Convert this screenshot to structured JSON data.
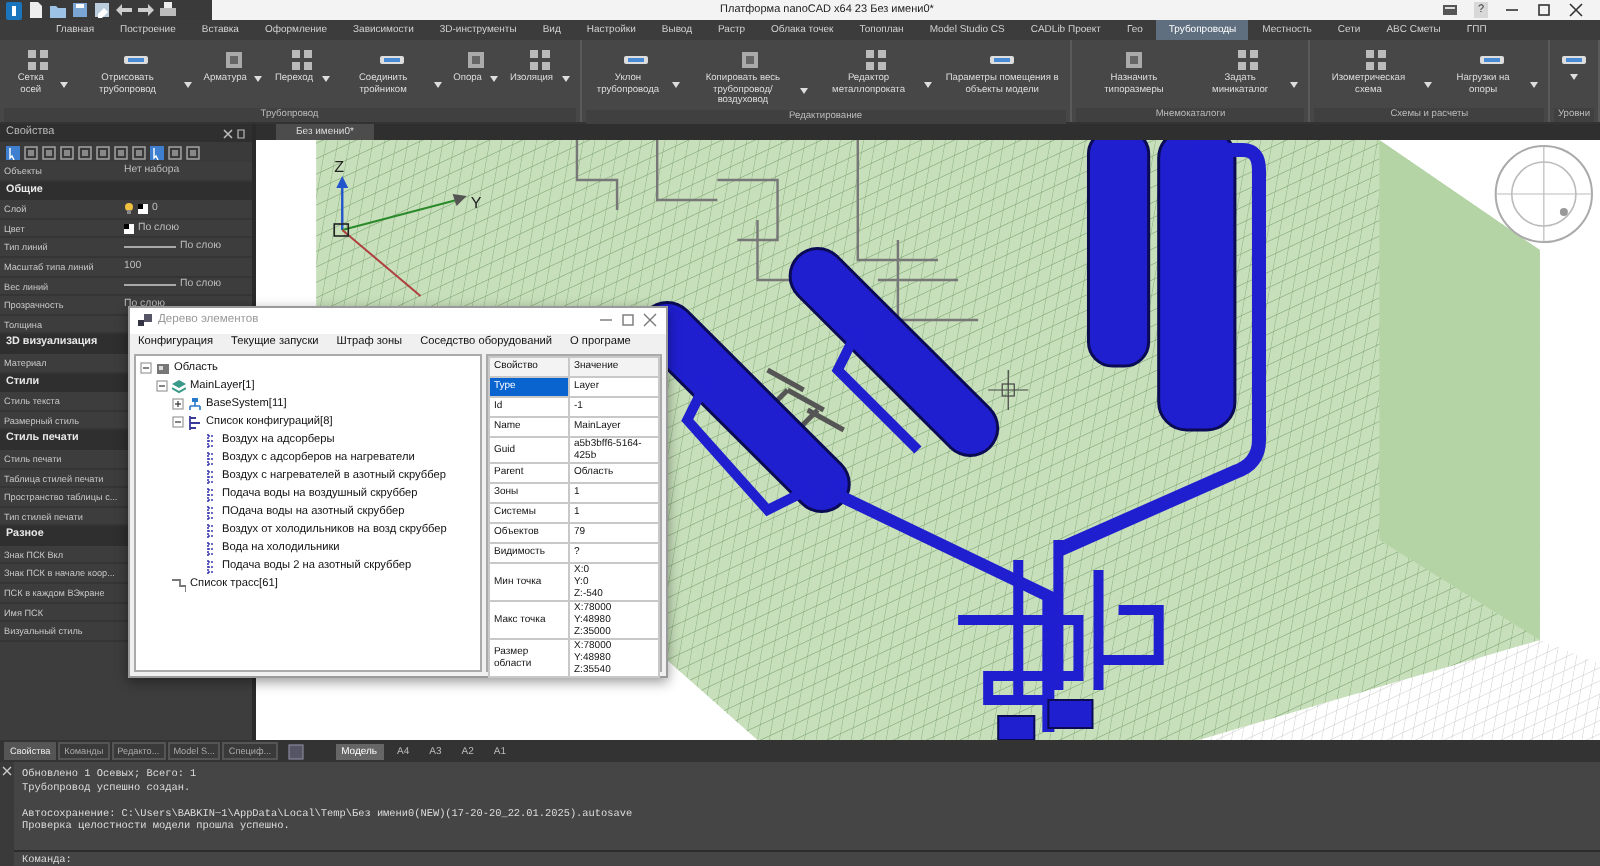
{
  "window": {
    "title": "Платформа nanoCAD x64 23 Без имени0*",
    "help": "?"
  },
  "ribbon_tabs": [
    {
      "label": "Главная",
      "selected": false
    },
    {
      "label": "Построение",
      "selected": false
    },
    {
      "label": "Вставка",
      "selected": false
    },
    {
      "label": "Оформление",
      "selected": false
    },
    {
      "label": "Зависимости",
      "selected": false
    },
    {
      "label": "3D-инструменты",
      "selected": false
    },
    {
      "label": "Вид",
      "selected": false
    },
    {
      "label": "Настройки",
      "selected": false
    },
    {
      "label": "Вывод",
      "selected": false
    },
    {
      "label": "Растр",
      "selected": false
    },
    {
      "label": "Облака точек",
      "selected": false
    },
    {
      "label": "Топоплан",
      "selected": false
    },
    {
      "label": "Model Studio CS",
      "selected": false
    },
    {
      "label": "CADLib Проект",
      "selected": false
    },
    {
      "label": "Гео",
      "selected": false
    },
    {
      "label": "Трубопроводы",
      "selected": true
    },
    {
      "label": "Местность",
      "selected": false
    },
    {
      "label": "Сети",
      "selected": false
    },
    {
      "label": "ABC Сметы",
      "selected": false
    },
    {
      "label": "ГПП",
      "selected": false
    }
  ],
  "ribbon_groups": [
    {
      "label": "Трубопровод",
      "buttons": [
        {
          "label": "Сетка осей",
          "dropdown": true
        },
        {
          "label": "Отрисовать трубопровод",
          "dropdown": true
        },
        {
          "label": "Арматура",
          "dropdown": true
        },
        {
          "label": "Переход",
          "dropdown": true
        },
        {
          "label": "Соединить тройником",
          "dropdown": true
        },
        {
          "label": "Опора",
          "dropdown": true
        },
        {
          "label": "Изоляция",
          "dropdown": true
        }
      ]
    },
    {
      "label": "Редактирование",
      "buttons": [
        {
          "label": "Уклон трубопровода",
          "dropdown": true
        },
        {
          "label": "Копировать весь трубопровод/воздуховод",
          "dropdown": true
        },
        {
          "label": "Редактор металлопроката",
          "dropdown": true
        },
        {
          "label": "Параметры помещения в объекты модели",
          "dropdown": false
        }
      ]
    },
    {
      "label": "Мнемокаталоги",
      "buttons": [
        {
          "label": "Назначить типоразмеры",
          "dropdown": false
        },
        {
          "label": "Задать миникаталог",
          "dropdown": true
        }
      ]
    },
    {
      "label": "Схемы и расчеты",
      "buttons": [
        {
          "label": "Изометрическая схема",
          "dropdown": true
        },
        {
          "label": "Нагрузки на опоры",
          "dropdown": true
        }
      ]
    },
    {
      "label": "Уровни",
      "buttons": [
        {
          "dropdown": true
        }
      ]
    }
  ],
  "properties_panel": {
    "title": "Свойства",
    "rows": [
      {
        "kind": "row",
        "label": "Объекты",
        "value": "Нет набора"
      },
      {
        "kind": "section",
        "label": "Общие"
      },
      {
        "kind": "layer",
        "label": "Слой",
        "value": "0"
      },
      {
        "kind": "color",
        "label": "Цвет",
        "value": "По слою"
      },
      {
        "kind": "linetype",
        "label": "Тип линий",
        "value": "По слою"
      },
      {
        "kind": "row",
        "label": "Масштаб типа линий",
        "value": "100"
      },
      {
        "kind": "linetype",
        "label": "Вес линий",
        "value": "По слою"
      },
      {
        "kind": "row",
        "label": "Прозрачность",
        "value": "По слою"
      },
      {
        "kind": "row",
        "label": "Толщина"
      },
      {
        "kind": "section",
        "label": "3D визуализация"
      },
      {
        "kind": "row",
        "label": "Материал"
      },
      {
        "kind": "section",
        "label": "Стили"
      },
      {
        "kind": "row",
        "label": "Стиль текста"
      },
      {
        "kind": "row",
        "label": "Размерный стиль"
      },
      {
        "kind": "section",
        "label": "Стиль печати"
      },
      {
        "kind": "row",
        "label": "Стиль печати"
      },
      {
        "kind": "row",
        "label": "Таблица стилей печати"
      },
      {
        "kind": "row",
        "label": "Пространство таблицы с..."
      },
      {
        "kind": "row",
        "label": "Тип стилей печати"
      },
      {
        "kind": "section",
        "label": "Разное"
      },
      {
        "kind": "row",
        "label": "Знак ПСК Вкл"
      },
      {
        "kind": "row",
        "label": "Знак ПСК в начале коор..."
      },
      {
        "kind": "row",
        "label": "ПСК в каждом ВЭкране"
      },
      {
        "kind": "row",
        "label": "Имя ПСК"
      },
      {
        "kind": "row",
        "label": "Визуальный стиль"
      }
    ]
  },
  "document_tabs": [
    {
      "label": "Без имени0*",
      "selected": true
    }
  ],
  "viewport": {
    "axis_labels": [
      "Z",
      "Y"
    ]
  },
  "dialog": {
    "title": "Дерево элементов",
    "menu": [
      "Конфигурация",
      "Текущие запуски",
      "Штраф зоны",
      "Соседство оборудований",
      "О програме"
    ],
    "tree": [
      {
        "label": "Область",
        "kind": "area",
        "expanded": true,
        "children": [
          {
            "label": "MainLayer[1]",
            "kind": "layer",
            "expanded": true,
            "children": [
              {
                "label": "BaseSystem[11]",
                "kind": "system",
                "expanded": false
              },
              {
                "label": "Список конфигураций[8]",
                "kind": "config-list",
                "expanded": true,
                "children": [
                  {
                    "label": "Воздух на адсорберы",
                    "kind": "config"
                  },
                  {
                    "label": "Воздух с адсорберов на нагреватели",
                    "kind": "config"
                  },
                  {
                    "label": "Воздух с нагревателей в азотный скруббер",
                    "kind": "config"
                  },
                  {
                    "label": "Подача воды на воздушный скруббер",
                    "kind": "config"
                  },
                  {
                    "label": "ПОдача воды на азотный скруббер",
                    "kind": "config"
                  },
                  {
                    "label": "Воздух от холодильников на возд скруббер",
                    "kind": "config"
                  },
                  {
                    "label": "Вода на холодильники",
                    "kind": "config"
                  },
                  {
                    "label": "Подача воды 2 на азотный скруббер",
                    "kind": "config"
                  }
                ]
              }
            ]
          },
          {
            "label": "Список трасс[61]",
            "kind": "route-list"
          }
        ]
      }
    ],
    "grid_columns": [
      "Свойство",
      "Значение"
    ],
    "grid_rows": [
      {
        "property": "Type",
        "value": "Layer",
        "selected": true
      },
      {
        "property": "Id",
        "value": "-1",
        "selected": false
      },
      {
        "property": "Name",
        "value": "MainLayer",
        "selected": false
      },
      {
        "property": "Guid",
        "value": "a5b3bff6-5164-425b",
        "selected": false
      },
      {
        "property": "Parent",
        "value": "Область",
        "selected": false
      },
      {
        "property": "Зоны",
        "value": "1",
        "selected": false
      },
      {
        "property": "Системы",
        "value": "1",
        "selected": false
      },
      {
        "property": "Объектов",
        "value": "79",
        "selected": false
      },
      {
        "property": "Видимость",
        "value": "?",
        "selected": false
      },
      {
        "property": "Мин точка",
        "value": "X:0\nY:0\nZ:-540",
        "selected": false
      },
      {
        "property": "Макс точка",
        "value": "X:78000\nY:48980\nZ:35000",
        "selected": false
      },
      {
        "property": "Размер области",
        "value": "X:78000\nY:48980\nZ:35540",
        "selected": false
      }
    ]
  },
  "panel_tabs": [
    {
      "label": "Свойства",
      "selected": true
    },
    {
      "label": "Команды",
      "selected": false
    },
    {
      "label": "Редакто...",
      "selected": false
    },
    {
      "label": "Model S...",
      "selected": false
    },
    {
      "label": "Специф...",
      "selected": false
    }
  ],
  "layout_tabs": [
    {
      "label": "Модель",
      "selected": true
    },
    {
      "label": "A4",
      "selected": false
    },
    {
      "label": "A3",
      "selected": false
    },
    {
      "label": "A2",
      "selected": false
    },
    {
      "label": "A1",
      "selected": false
    }
  ],
  "command_log": [
    {
      "text": "Обновлено 1 Осевых; Всего: 1",
      "gap_before": false
    },
    {
      "text": "Трубопровод успешно создан.",
      "gap_before": false
    },
    {
      "text": "Автосохранение: C:\\Users\\BABKIN~1\\AppData\\Local\\Temp\\Без имени0(NEW)(17-20-20_22.01.2025).autosave",
      "gap_before": true
    },
    {
      "text": "Проверка целостности модели прошла успешно.",
      "gap_before": false
    }
  ],
  "command_prompt": "Команда:"
}
